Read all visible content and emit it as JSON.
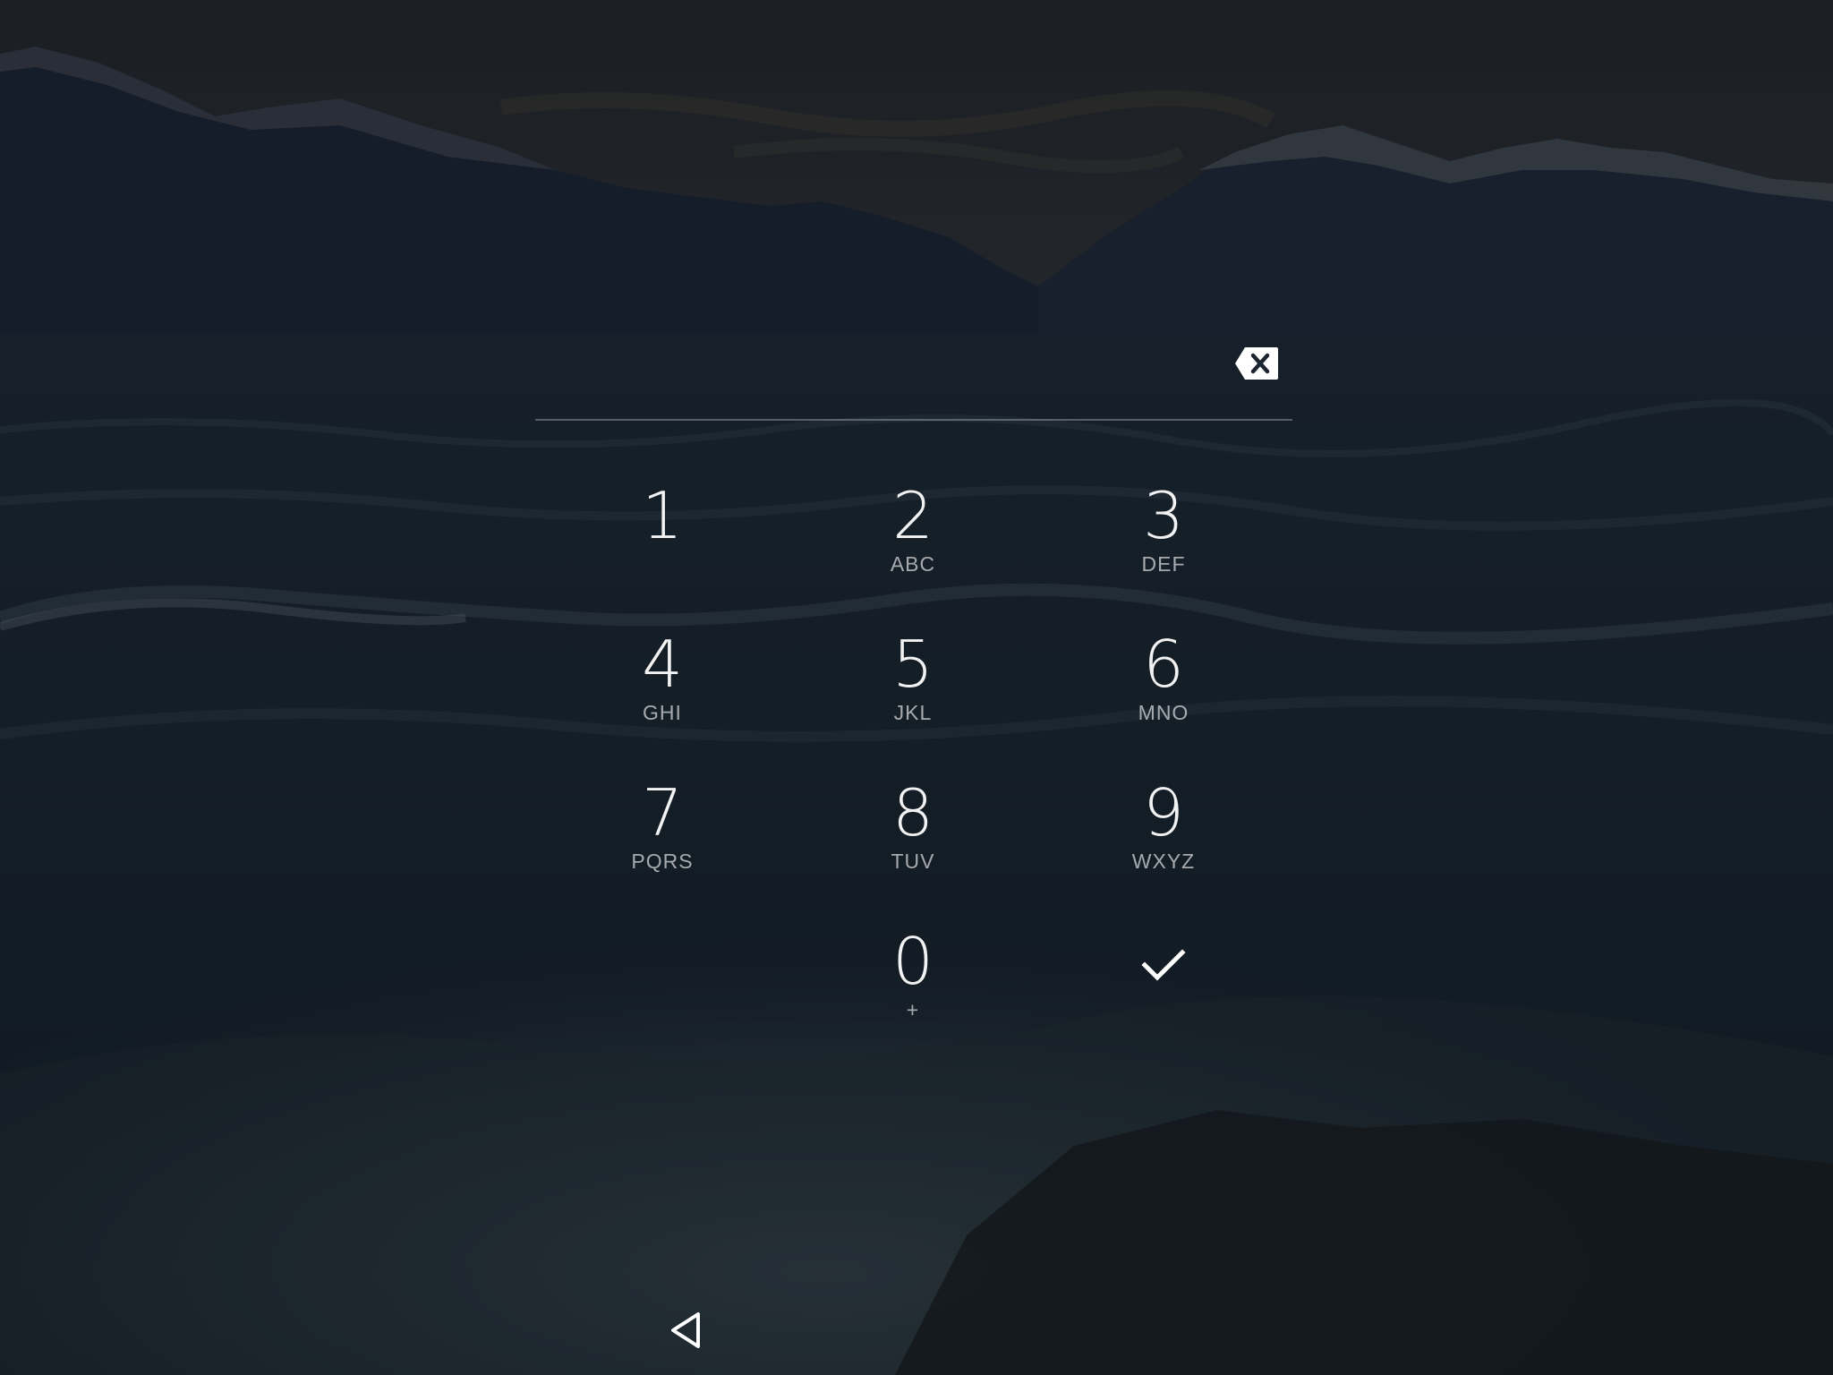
{
  "keypad": {
    "keys": [
      {
        "digit": "1",
        "letters": ""
      },
      {
        "digit": "2",
        "letters": "ABC"
      },
      {
        "digit": "3",
        "letters": "DEF"
      },
      {
        "digit": "4",
        "letters": "GHI"
      },
      {
        "digit": "5",
        "letters": "JKL"
      },
      {
        "digit": "6",
        "letters": "MNO"
      },
      {
        "digit": "7",
        "letters": "PQRS"
      },
      {
        "digit": "8",
        "letters": "TUV"
      },
      {
        "digit": "9",
        "letters": "WXYZ"
      },
      {
        "digit": "0",
        "letters": "+"
      }
    ]
  },
  "pin": {
    "value": ""
  },
  "icons": {
    "backspace": "backspace-icon",
    "enter": "checkmark-icon",
    "back": "back-triangle-icon"
  },
  "colors": {
    "text": "#ffffff",
    "secondary_text": "#a6a6a6",
    "overlay": "#0a0f16"
  }
}
